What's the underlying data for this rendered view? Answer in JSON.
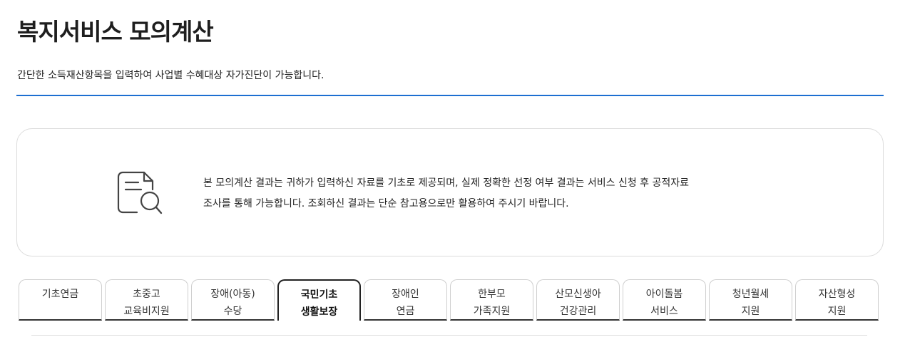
{
  "header": {
    "title": "복지서비스 모의계산",
    "description": "간단한 소득재산항목을 입력하여 사업별 수혜대상 자가진단이 가능합니다."
  },
  "notice": {
    "icon": "document-search-icon",
    "line1": "본 모의계산 결과는 귀하가 입력하신 자료를 기초로 제공되며, 실제 정확한 선정 여부 결과는 서비스 신청 후 공적자료",
    "line2": "조사를 통해 가능합니다. 조회하신 결과는 단순 참고용으로만 활용하여 주시기 바랍니다."
  },
  "tabs": [
    {
      "line1": "기초연금",
      "line2": ""
    },
    {
      "line1": "초중고",
      "line2": "교육비지원"
    },
    {
      "line1": "장애(아동)",
      "line2": "수당"
    },
    {
      "line1": "국민기초",
      "line2": "생활보장"
    },
    {
      "line1": "장애인",
      "line2": "연금"
    },
    {
      "line1": "한부모",
      "line2": "가족지원"
    },
    {
      "line1": "산모신생아",
      "line2": "건강관리"
    },
    {
      "line1": "아이돌봄",
      "line2": "서비스"
    },
    {
      "line1": "청년월세",
      "line2": "지원"
    },
    {
      "line1": "자산형성",
      "line2": "지원"
    }
  ],
  "active_tab": "국민기초 생활보장",
  "colors": {
    "accent": "#1d6fd1",
    "active_tab_border": "#222222"
  }
}
